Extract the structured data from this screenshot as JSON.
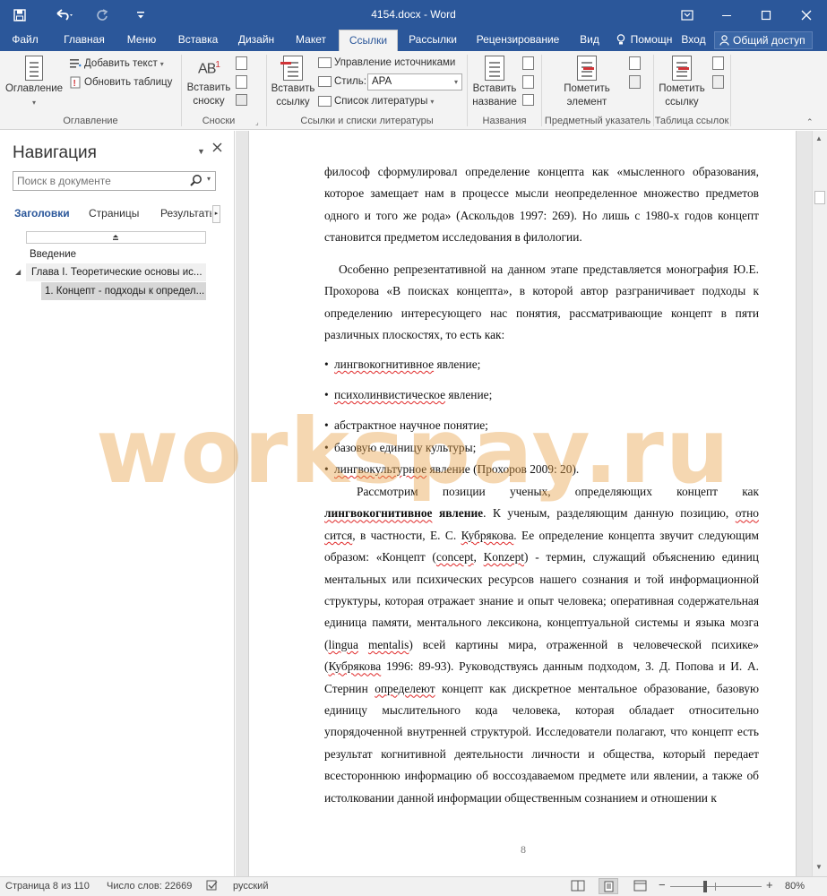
{
  "window": {
    "title": "4154.docx - Word",
    "controls": {
      "ribbon_display": "▣",
      "minimize": "—",
      "maximize": "☐",
      "close": "✕"
    }
  },
  "quick_access": {
    "save": "save-icon",
    "undo": "undo-icon",
    "redo": "redo-icon",
    "customize": "customize-icon"
  },
  "tabs": [
    {
      "label": "Файл"
    },
    {
      "label": "Главная"
    },
    {
      "label": "Меню"
    },
    {
      "label": "Вставка"
    },
    {
      "label": "Дизайн"
    },
    {
      "label": "Макет"
    },
    {
      "label": "Ссылки",
      "active": true
    },
    {
      "label": "Рассылки"
    },
    {
      "label": "Рецензирование"
    },
    {
      "label": "Вид"
    },
    {
      "label": "Помощн"
    },
    {
      "label": "Вход"
    }
  ],
  "share_label": "Общий доступ",
  "ribbon": {
    "toc": {
      "big_label_1": "Оглавление",
      "add_text": "Добавить текст",
      "update_table": "Обновить таблицу",
      "group": "Оглавление"
    },
    "footnotes": {
      "insert_line1": "Вставить",
      "insert_line2": "сноску",
      "group": "Сноски",
      "ab_text": "AB",
      "ab_sup": "1"
    },
    "citations": {
      "insert_line1": "Вставить",
      "insert_line2": "ссылку",
      "manage_sources": "Управление источниками",
      "style_label": "Стиль:",
      "style_value": "APA",
      "bibliography": "Список литературы",
      "group": "Ссылки и списки литературы"
    },
    "captions": {
      "insert_line1": "Вставить",
      "insert_line2": "название",
      "group": "Названия"
    },
    "index": {
      "mark_line1": "Пометить",
      "mark_line2": "элемент",
      "group": "Предметный указатель"
    },
    "toa": {
      "mark_line1": "Пометить",
      "mark_line2": "ссылку",
      "group": "Таблица ссылок"
    }
  },
  "nav": {
    "title": "Навигация",
    "search_placeholder": "Поиск в документе",
    "tabs": [
      "Заголовки",
      "Страницы",
      "Результать"
    ],
    "headings": [
      "Введение",
      "Глава I. Теоретические основы ис...",
      "1. Концепт - подходы к определ..."
    ]
  },
  "doc": {
    "p1_a": "философ сформулировал определение концепта как «мысленного образования, которое замещает нам в процессе мысли неопределенное множество предметов одного и того же рода» (Аскольдов 1997: 269). Но лишь с 1980-х годов концепт становится предметом исследования в филологии.",
    "p2": "Особенно репрезентативной на данном этапе представляется монография Ю.Е. Прохорова «В поисках концепта», в которой автор разграничивает подходы к определению интересующего нас понятия, рассматривающие концепт в пяти различных плоскостях, то есть как:",
    "b1_sq": "лингвокогнитивное",
    "b1_rest": " явление;",
    "b2_sq": "психолинвистическое",
    "b2_rest": " явление;",
    "b3": "абстрактное научное понятие;",
    "b4": "базовую единицу культуры;",
    "b5_sq": "лингвокультурное",
    "b5_rest": " явление (Прохоров 2009: 20).",
    "p3_a": "Рассмотрим позиции ученых, определяющих концепт как",
    "p3_bold_sq": "лингвокогнитивное",
    "p3_bold": " явление",
    "p3_b": ". К ученым, разделяющим данную позицию,",
    "p3_sq1": "отно сится",
    "p3_c": ", в частности, Е. С.",
    "p3_sq2": "Кубрякова",
    "p3_d": ". Ее определение концепта звучит следующим образом: «Концепт (",
    "p3_sq3": "concept",
    "p3_e": ",",
    "p3_sq4": "Konzept",
    "p3_f": ") - термин, служащий объяснению единиц ментальных или психических ресурсов нашего сознания и той информационной структуры, которая отражает знание и опыт человека; оперативная содержательная единица памяти, ментального лексикона, концептуальной системы и языка мозга (",
    "p3_sq5": "lingua",
    "p3_g": " ",
    "p3_sq6": "mentalis",
    "p3_h": ") всей картины мира, отраженной в человеческой психике» (",
    "p3_sq7": "Кубрякова",
    "p3_i": " 1996: 89-93). Руководствуясь данным подходом, З. Д. Попова и И. А. Стернин",
    "p3_sq8": "определеют",
    "p3_j": " концепт как дискретное ментальное образование, базовую единицу мыслительного кода человека, которая обладает относительно упорядоченной внутренней структурой. Исследователи полагают, что концепт есть результат когнитивной деятельности личности и общества, который передает всестороннюю информацию об воссоздаваемом предмете или явлении, а также об истолковании данной информации общественным сознанием и отношении к",
    "page_number": "8",
    "watermark": "workspay.ru"
  },
  "status": {
    "page": "Страница 8 из 110",
    "words": "Число слов: 22669",
    "language": "русский",
    "zoom": "80%",
    "zoom_level": 0.8
  }
}
